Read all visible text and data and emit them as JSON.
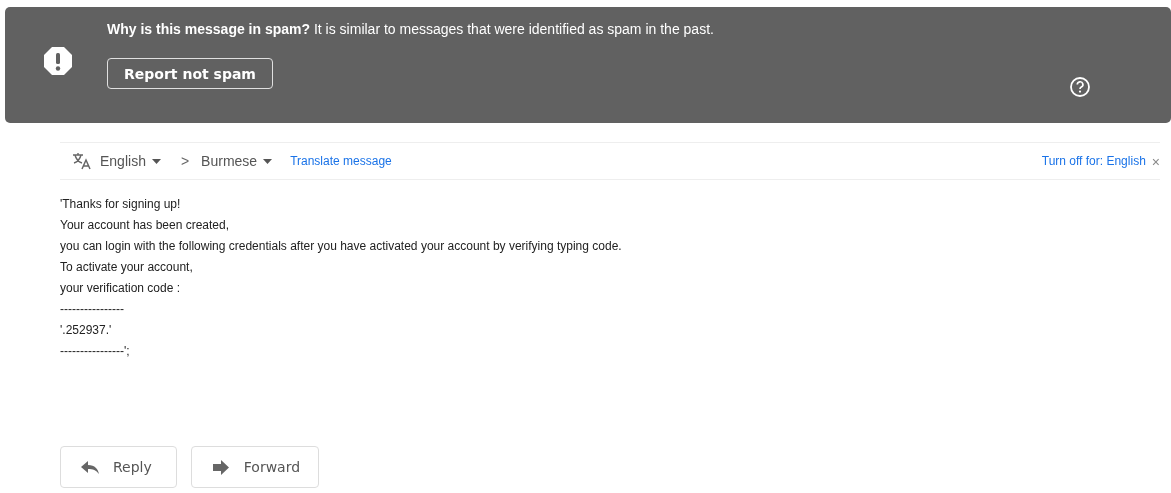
{
  "spam_banner": {
    "message": "**Why is this message in spam?** It is similar to messages that were identified as spam in the past.",
    "button": "Report not spam"
  },
  "translate_bar": {
    "source_language": "English",
    "arrow": ">",
    "target_language": "Burmese",
    "translate_link": "Translate message",
    "turn_off_link": "Turn off for: English",
    "close": "×"
  },
  "message_body": [
    "'Thanks for signing up!",
    "Your account has been created,",
    "you can login with the following credentials after you have activated your account by verifying typing code.",
    "To activate your account,",
    "your verification code :",
    "----------------",
    "'.252937.'",
    "----------------';"
  ],
  "actions": [
    {
      "kind": "reply",
      "label": "Reply"
    },
    {
      "kind": "forward",
      "label": "Forward"
    }
  ]
}
